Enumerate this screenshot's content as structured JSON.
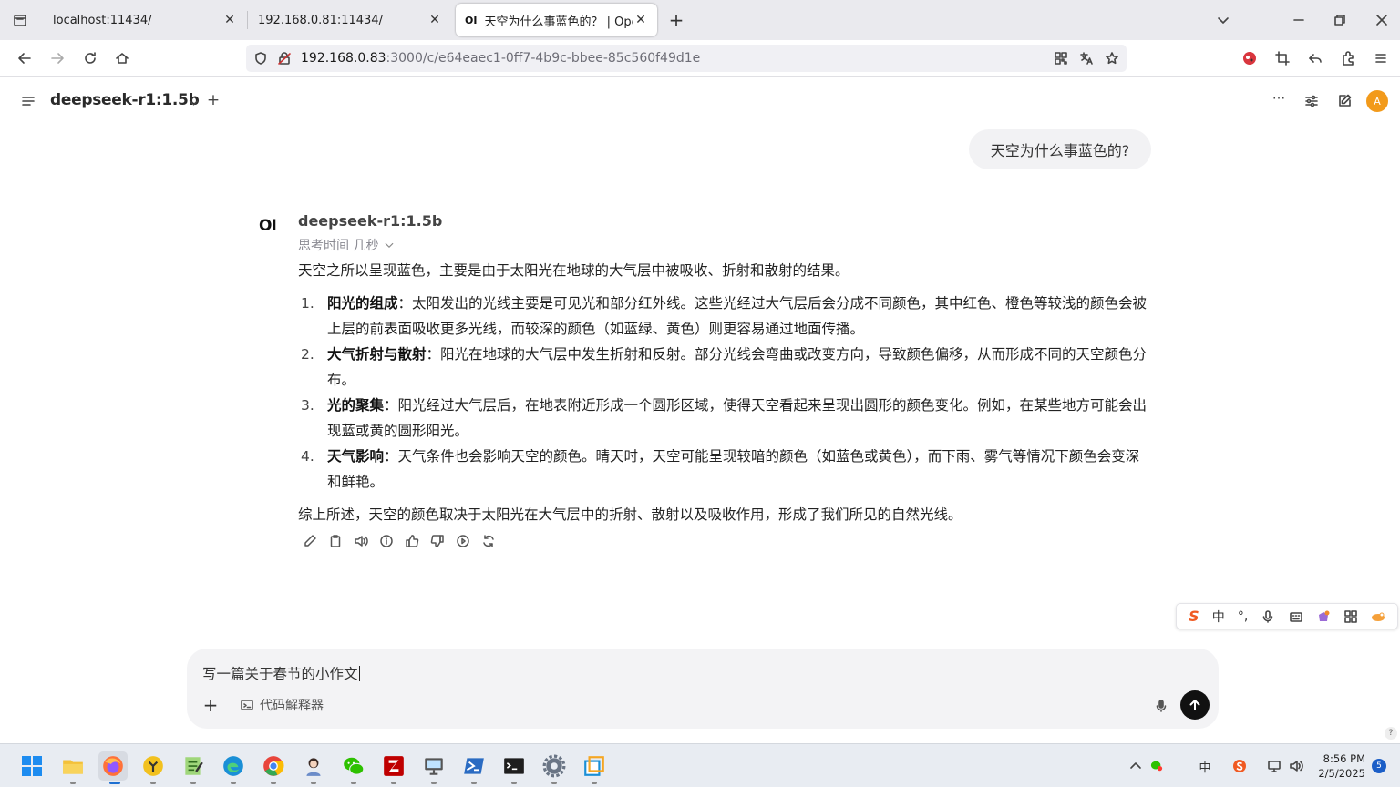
{
  "browser": {
    "tabs": [
      {
        "title": "localhost:11434/",
        "close": "✕",
        "favicon": ""
      },
      {
        "title": "192.168.0.81:11434/",
        "close": "✕",
        "favicon": ""
      },
      {
        "title": "天空为什么事蓝色的？ | Open WebUI",
        "close": "✕",
        "favicon": "OI"
      }
    ],
    "new_tab": "+",
    "url_host": "192.168.0.83",
    "url_path": ":3000/c/e64eaec1-0ff7-4b9c-bbee-85c560f49d1e"
  },
  "app": {
    "model_name": "deepseek-r1:1.5b",
    "add_model": "+",
    "more": "···",
    "avatar_letter": "A",
    "accent": "#f29a1b"
  },
  "chat": {
    "user_message": "天空为什么事蓝色的?",
    "assistant_logo": "OI",
    "assistant_name": "deepseek-r1:1.5b",
    "thinking": "思考时间 几秒",
    "intro": "天空之所以呈现蓝色，主要是由于太阳光在地球的大气层中被吸收、折射和散射的结果。",
    "items": [
      {
        "num": "1.",
        "title": "阳光的组成",
        "sep": "：",
        "text": "太阳发出的光线主要是可见光和部分红外线。这些光经过大气层后会分成不同颜色，其中红色、橙色等较浅的颜色会被上层的前表面吸收更多光线，而较深的颜色（如蓝绿、黄色）则更容易通过地面传播。"
      },
      {
        "num": "2.",
        "title": "大气折射与散射",
        "sep": "：",
        "text": "阳光在地球的大气层中发生折射和反射。部分光线会弯曲或改变方向，导致颜色偏移，从而形成不同的天空颜色分布。"
      },
      {
        "num": "3.",
        "title": "光的聚集",
        "sep": "：",
        "text": "阳光经过大气层后，在地表附近形成一个圆形区域，使得天空看起来呈现出圆形的颜色变化。例如，在某些地方可能会出现蓝或黄的圆形阳光。"
      },
      {
        "num": "4.",
        "title": "天气影响",
        "sep": "：",
        "text": "天气条件也会影响天空的颜色。晴天时，天空可能呈现较暗的颜色（如蓝色或黄色），而下雨、雾气等情况下颜色会变深和鲜艳。"
      }
    ],
    "conclusion": "综上所述，天空的颜色取决于太阳光在大气层中的折射、散射以及吸收作用，形成了我们所见的自然光线。"
  },
  "ime": {
    "logo": "S",
    "mode": "中",
    "punct": "°,"
  },
  "input": {
    "value": "写一篇关于春节的小作文",
    "plus": "+",
    "code_interpreter": "代码解释器",
    "help": "?"
  },
  "taskbar": {
    "time": "8:56 PM",
    "date": "2/5/2025",
    "notifications": "5",
    "ime_indicator": "中"
  }
}
